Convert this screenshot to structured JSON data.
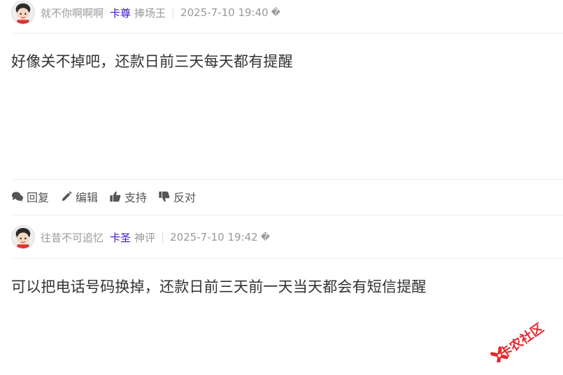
{
  "posts": [
    {
      "username": "就不你啊啊啊",
      "rank": "卡尊",
      "title": "捧场王",
      "time": "2025-7-10 19:40",
      "more": "�",
      "content": "好像关不掉吧，还款日前三天每天都有提醒"
    },
    {
      "username": "往昔不可追忆",
      "rank": "卡圣",
      "title": "神评",
      "time": "2025-7-10 19:42",
      "more": "�",
      "content": "可以把电话号码换掉，还款日前三天前一天当天都会有短信提醒"
    }
  ],
  "actions": {
    "reply": "回复",
    "edit": "编辑",
    "support": "支持",
    "oppose": "反对"
  },
  "watermark": {
    "text": "卡农社区"
  },
  "colors": {
    "rank": "#3b0fd0",
    "watermark": "#e8262c"
  }
}
